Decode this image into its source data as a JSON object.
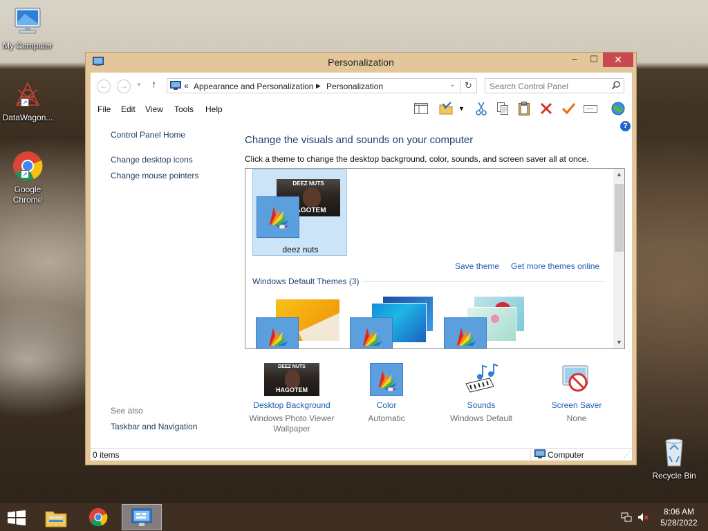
{
  "desktop": {
    "icons": [
      {
        "label": "My Computer"
      },
      {
        "label": "DataWagon..."
      },
      {
        "label": "Google Chrome"
      },
      {
        "label": "Recycle Bin"
      }
    ]
  },
  "window": {
    "title": "Personalization",
    "controls": {
      "minimize": "–",
      "maximize": "☐",
      "close": "✕"
    },
    "address": {
      "overflow": "«",
      "crumbs": [
        "Appearance and Personalization",
        "Personalization"
      ]
    },
    "search": {
      "placeholder": "Search Control Panel"
    },
    "menu": [
      "File",
      "Edit",
      "View",
      "Tools",
      "Help"
    ],
    "left_pane": {
      "home": "Control Panel Home",
      "links": [
        "Change desktop icons",
        "Change mouse pointers"
      ],
      "see_also_title": "See also",
      "see_also_links": [
        "Taskbar and Navigation"
      ]
    },
    "main": {
      "heading": "Change the visuals and sounds on your computer",
      "subtext": "Click a theme to change the desktop background, color, sounds, and screen saver all at once.",
      "my_theme": {
        "name": "deez nuts",
        "thumb_top_text": "DEEZ NUTS",
        "thumb_bottom_text": "HAGOTEM"
      },
      "save_theme": "Save theme",
      "get_more": "Get more themes online",
      "default_section": "Windows Default Themes (3)",
      "default_theme_count": 3
    },
    "bottom": [
      {
        "title": "Desktop Background",
        "sub": "Windows Photo Viewer Wallpaper"
      },
      {
        "title": "Color",
        "sub": "Automatic"
      },
      {
        "title": "Sounds",
        "sub": "Windows Default"
      },
      {
        "title": "Screen Saver",
        "sub": "None"
      }
    ],
    "status": {
      "items": "0 items",
      "location": "Computer"
    }
  },
  "taskbar": {
    "time": "8:06 AM",
    "date": "5/28/2022"
  },
  "colors": {
    "window_frame": "#e3c79a",
    "close_button": "#c74a50",
    "link_blue": "#1a5fb4",
    "heading_blue": "#1e3e72",
    "selection": "#cce4f7",
    "taskbar": "#3f2f22"
  }
}
